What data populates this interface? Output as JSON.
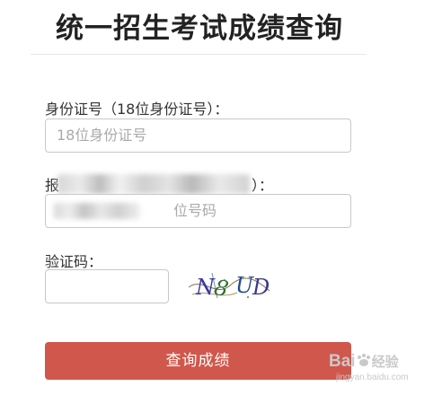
{
  "page": {
    "title": "统一招生考试成绩查询"
  },
  "form": {
    "id_label": "身份证号（18位身份证号）：",
    "id_placeholder": "18位身份证号",
    "exam_label_visible": "报",
    "exam_label_tail": "）：",
    "exam_placeholder_tail": "位号码",
    "captcha_label": "验证码：",
    "captcha_value": "",
    "captcha_image_text": "N8UD",
    "submit_label": "查询成绩"
  },
  "colors": {
    "submit_bg": "#d0574c",
    "border": "#c8c8c8",
    "title": "#222222"
  },
  "watermark": {
    "brand": "Bai",
    "brand_tail": "经验",
    "sub": "jingyan.baidu.com",
    "icon": "paw-icon"
  }
}
